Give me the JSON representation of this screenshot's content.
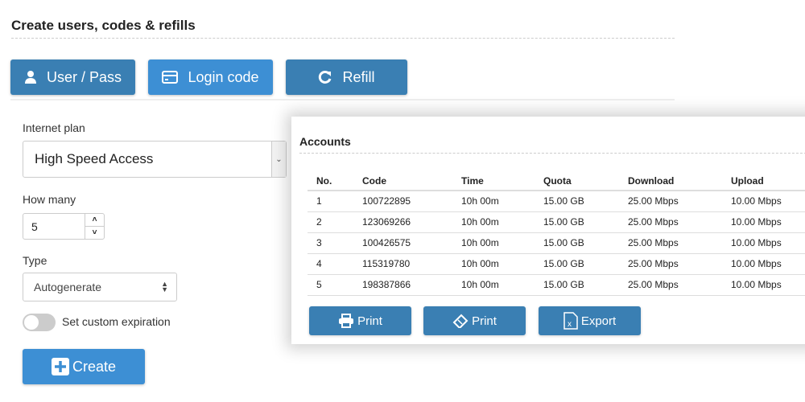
{
  "page": {
    "title": "Create users, codes & refills"
  },
  "tabs": [
    {
      "label": "User / Pass",
      "icon": "user-icon"
    },
    {
      "label": "Login code",
      "icon": "card-icon"
    },
    {
      "label": "Refill",
      "icon": "refresh-icon"
    }
  ],
  "form": {
    "plan_label": "Internet plan",
    "plan_value": "High Speed Access",
    "count_label": "How many",
    "count_value": "5",
    "type_label": "Type",
    "type_value": "Autogenerate",
    "expiration_label": "Set custom expiration",
    "expiration_on": false,
    "create_label": "Create"
  },
  "accounts": {
    "title": "Accounts",
    "columns": [
      "No.",
      "Code",
      "Time",
      "Quota",
      "Download",
      "Upload"
    ],
    "rows": [
      [
        "1",
        "100722895",
        "10h 00m",
        "15.00 GB",
        "25.00 Mbps",
        "10.00 Mbps"
      ],
      [
        "2",
        "123069266",
        "10h 00m",
        "15.00 GB",
        "25.00 Mbps",
        "10.00 Mbps"
      ],
      [
        "3",
        "100426575",
        "10h 00m",
        "15.00 GB",
        "25.00 Mbps",
        "10.00 Mbps"
      ],
      [
        "4",
        "115319780",
        "10h 00m",
        "15.00 GB",
        "25.00 Mbps",
        "10.00 Mbps"
      ],
      [
        "5",
        "198387866",
        "10h 00m",
        "15.00 GB",
        "25.00 Mbps",
        "10.00 Mbps"
      ]
    ],
    "buttons": [
      {
        "label": "Print",
        "icon": "printer-icon"
      },
      {
        "label": "Print",
        "icon": "ticket-icon"
      },
      {
        "label": "Export",
        "icon": "excel-icon"
      }
    ]
  },
  "colors": {
    "primary": "#3a7fb3",
    "active": "#3d8fd4"
  }
}
